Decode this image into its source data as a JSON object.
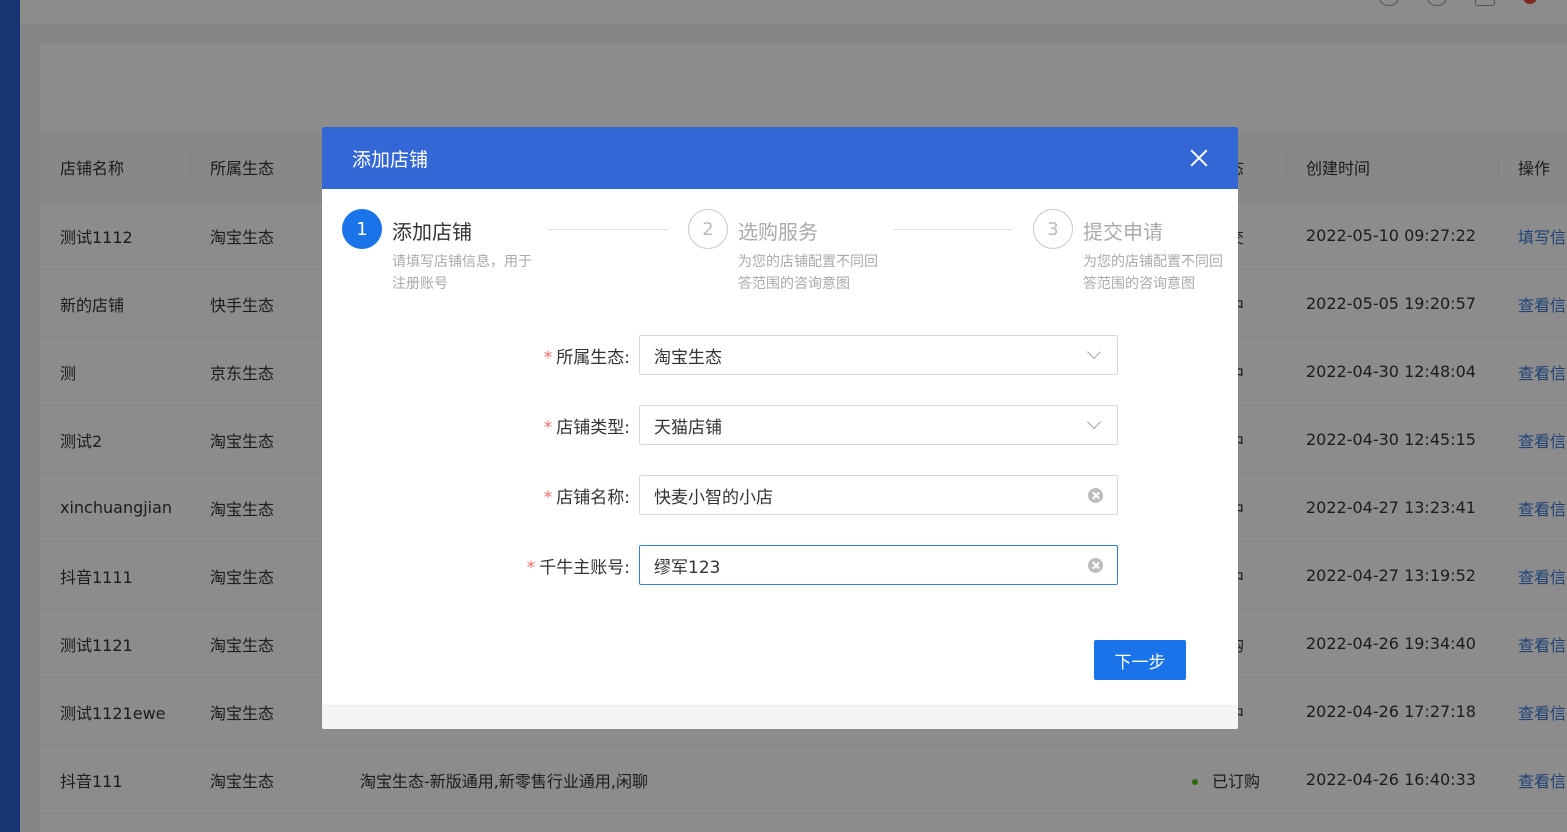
{
  "table": {
    "headers": [
      "店铺名称",
      "所属生态",
      "状态",
      "创建时间",
      "操作"
    ],
    "rows": [
      {
        "name": "测试1112",
        "eco": "淘宝生态",
        "services": "",
        "status": "提交",
        "time": "2022-05-10 09:27:22",
        "action": "填写信"
      },
      {
        "name": "新的店铺",
        "eco": "快手生态",
        "services": "",
        "status": "核中",
        "time": "2022-05-05 19:20:57",
        "action": "查看信"
      },
      {
        "name": "测",
        "eco": "京东生态",
        "services": "",
        "status": "核中",
        "time": "2022-04-30 12:48:04",
        "action": "查看信"
      },
      {
        "name": "测试2",
        "eco": "淘宝生态",
        "services": "",
        "status": "核中",
        "time": "2022-04-30 12:45:15",
        "action": "查看信"
      },
      {
        "name": "xinchuangjian",
        "eco": "淘宝生态",
        "services": "",
        "status": "核中",
        "time": "2022-04-27 13:23:41",
        "action": "查看信"
      },
      {
        "name": "抖音1111",
        "eco": "淘宝生态",
        "services": "",
        "status": "核中",
        "time": "2022-04-27 13:19:52",
        "action": "查看信"
      },
      {
        "name": "测试1121",
        "eco": "淘宝生态",
        "services": "",
        "status": "订购",
        "time": "2022-04-26 19:34:40",
        "action": "查看信"
      },
      {
        "name": "测试1121ewe",
        "eco": "淘宝生态",
        "services": "",
        "status": "核中",
        "time": "2022-04-26 17:27:18",
        "action": "查看信"
      },
      {
        "name": "抖音111",
        "eco": "淘宝生态",
        "services": "淘宝生态-新版通用,新零售行业通用,闲聊",
        "status": "已订购",
        "time": "2022-04-26 16:40:33",
        "action": "查看信"
      }
    ]
  },
  "modal": {
    "title": "添加店铺",
    "steps": [
      {
        "num": "1",
        "title": "添加店铺",
        "desc": "请填写店铺信息，用于注册账号"
      },
      {
        "num": "2",
        "title": "选购服务",
        "desc": "为您的店铺配置不同回答范围的咨询意图"
      },
      {
        "num": "3",
        "title": "提交申请",
        "desc": "为您的店铺配置不同回答范围的咨询意图"
      }
    ],
    "fields": [
      {
        "label": "所属生态:",
        "value": "淘宝生态"
      },
      {
        "label": "店铺类型:",
        "value": "天猫店铺"
      },
      {
        "label": "店铺名称:",
        "value": "快麦小智的小店"
      },
      {
        "label": "千牛主账号:",
        "value": "缪军123"
      }
    ],
    "required_mark": "*",
    "next_label": "下一步"
  },
  "colors": {
    "primary": "#1a73e8",
    "header": "#3367d6",
    "link": "#3a7bd5",
    "required": "#f56c6c",
    "status_dot": "#52c41a"
  }
}
